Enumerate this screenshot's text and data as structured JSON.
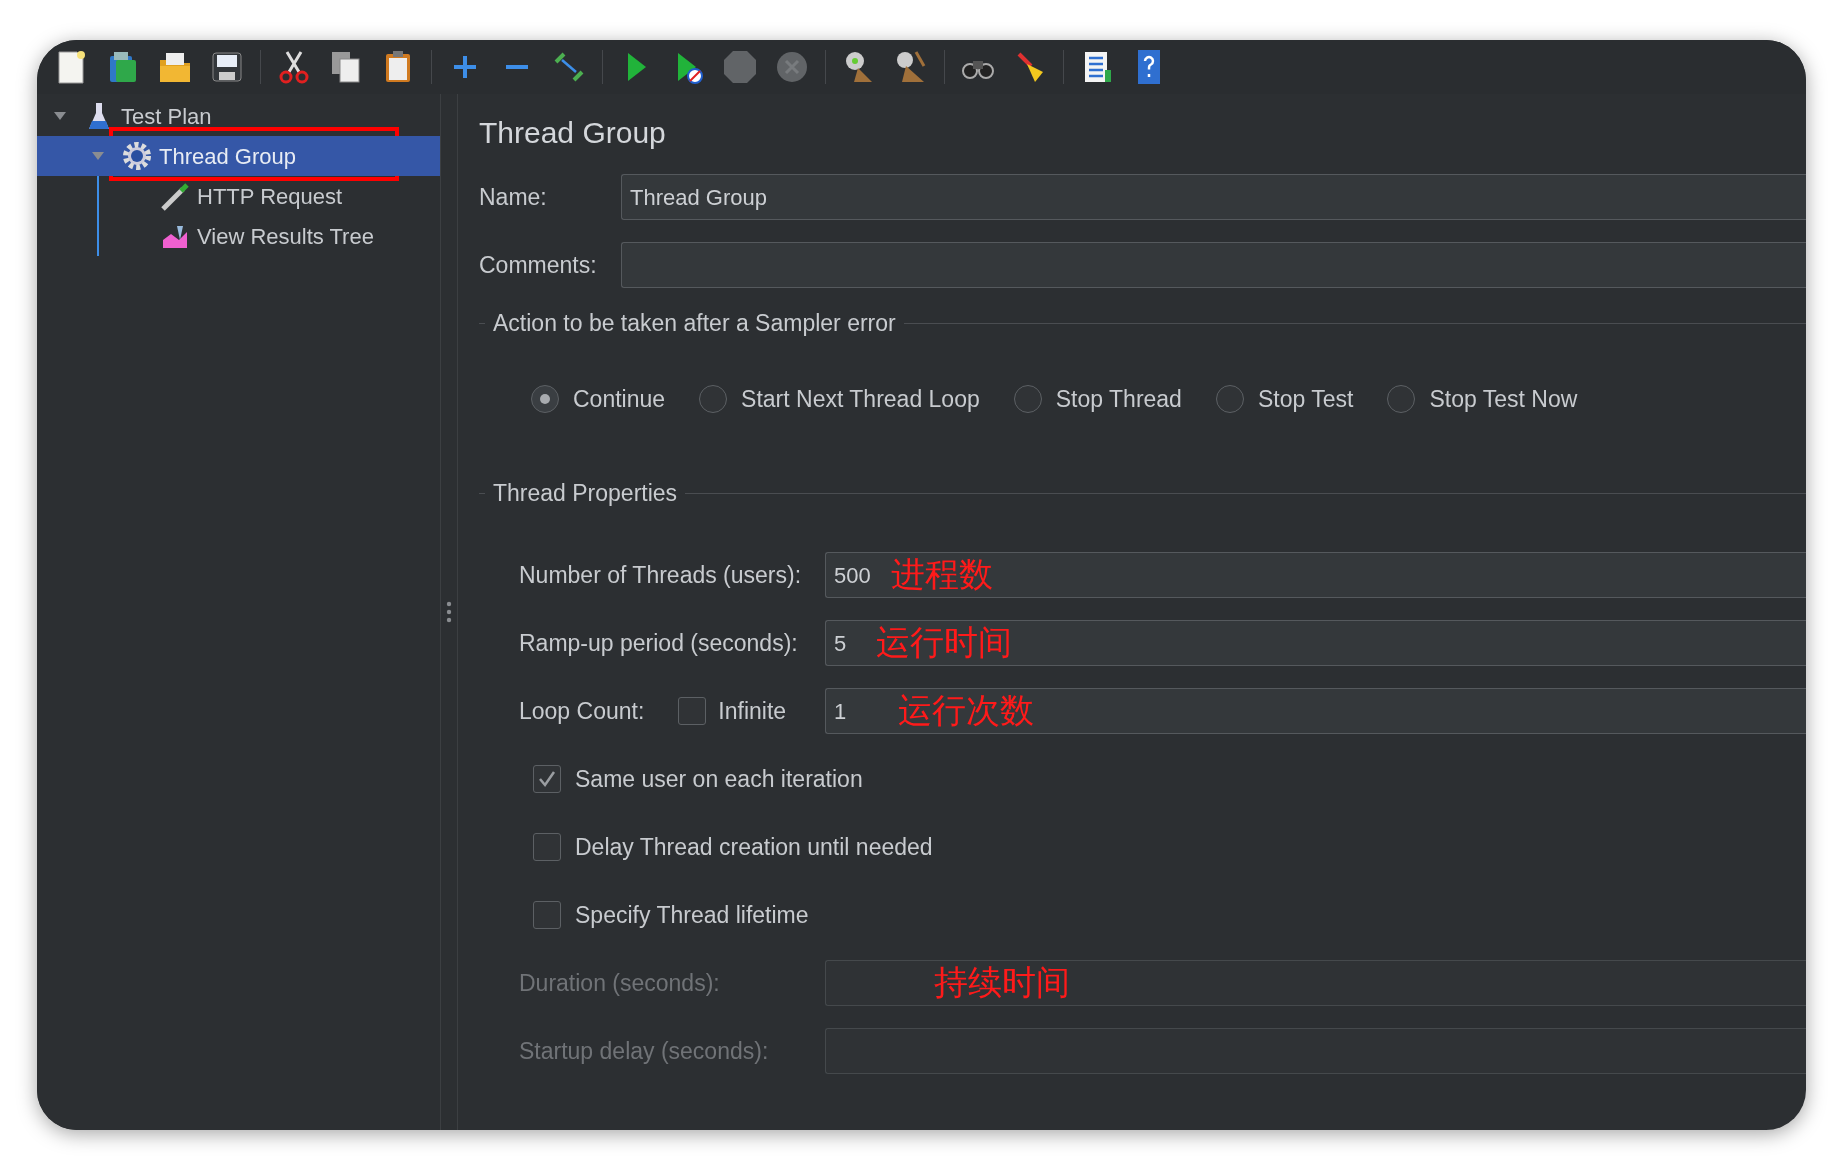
{
  "toolbar": [
    [
      {
        "kind": "new",
        "disabled": false
      },
      {
        "kind": "templates",
        "disabled": false
      },
      {
        "kind": "open",
        "disabled": false
      },
      {
        "kind": "save",
        "disabled": false
      }
    ],
    [
      {
        "kind": "cut",
        "disabled": false
      },
      {
        "kind": "copy",
        "disabled": false
      },
      {
        "kind": "paste",
        "disabled": false
      }
    ],
    [
      {
        "kind": "expand",
        "disabled": false
      },
      {
        "kind": "collapse",
        "disabled": false
      },
      {
        "kind": "toggle",
        "disabled": false
      }
    ],
    [
      {
        "kind": "start",
        "disabled": false
      },
      {
        "kind": "start_no_timers",
        "disabled": false
      },
      {
        "kind": "stop",
        "disabled": true
      },
      {
        "kind": "shutdown",
        "disabled": true
      }
    ],
    [
      {
        "kind": "clear",
        "disabled": false
      },
      {
        "kind": "clear_all",
        "disabled": false
      }
    ],
    [
      {
        "kind": "search",
        "disabled": false
      },
      {
        "kind": "reset_search",
        "disabled": false
      }
    ],
    [
      {
        "kind": "log",
        "disabled": false
      },
      {
        "kind": "help",
        "disabled": false
      }
    ]
  ],
  "tree": [
    {
      "label": "Test Plan",
      "kind": "plan",
      "expanded": true,
      "selected": false,
      "annotation_box": false,
      "children": [
        {
          "label": "Thread Group",
          "kind": "thread_group",
          "expanded": true,
          "selected": true,
          "annotation_box": true,
          "children": [
            {
              "label": "HTTP Request",
              "kind": "sampler",
              "selected": false,
              "annotation_box": false
            },
            {
              "label": "View Results Tree",
              "kind": "listener",
              "selected": false,
              "annotation_box": false
            }
          ]
        }
      ]
    }
  ],
  "panel": {
    "title": "Thread Group",
    "name": {
      "label": "Name:",
      "value": "Thread Group"
    },
    "comments": {
      "label": "Comments:"
    },
    "sampler_error": {
      "legend": "Action to be taken after a Sampler error",
      "options": [
        {
          "label": "Continue",
          "selected": true
        },
        {
          "label": "Start Next Thread Loop",
          "selected": false
        },
        {
          "label": "Stop Thread",
          "selected": false
        },
        {
          "label": "Stop Test",
          "selected": false
        },
        {
          "label": "Stop Test Now",
          "selected": false
        }
      ]
    },
    "thread_properties": {
      "legend": "Thread Properties",
      "rows": [
        {
          "kind": "field",
          "label": "Number of Threads (users):",
          "value": "500",
          "annotation": "进程数",
          "disabled": false
        },
        {
          "kind": "field",
          "label": "Ramp-up period (seconds):",
          "value": "5",
          "annotation": "运行时间",
          "disabled": false
        },
        {
          "kind": "loop",
          "label": "Loop Count:",
          "checkbox": {
            "label": "Infinite",
            "checked": false
          },
          "value": "1",
          "annotation": "运行次数",
          "disabled": false
        },
        {
          "kind": "checkbox",
          "label": "Same user on each iteration",
          "checked": true
        },
        {
          "kind": "checkbox",
          "label": "Delay Thread creation until needed",
          "checked": false
        },
        {
          "kind": "checkbox",
          "label": "Specify Thread lifetime",
          "checked": false
        },
        {
          "kind": "field",
          "label": "Duration (seconds):",
          "annotation": "持续时间",
          "disabled": true
        },
        {
          "kind": "field",
          "label": "Startup delay (seconds):",
          "disabled": true
        }
      ]
    }
  }
}
